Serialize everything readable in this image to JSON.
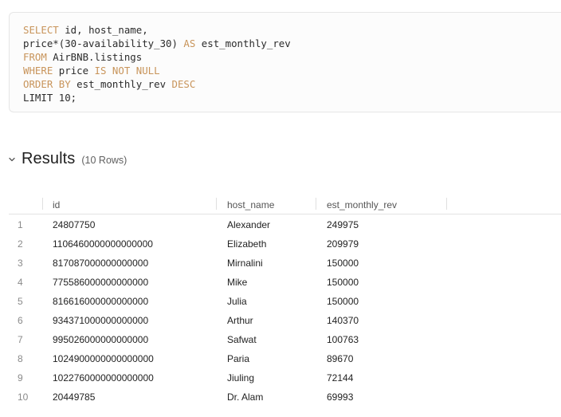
{
  "query": {
    "lines": [
      [
        {
          "t": "SELECT",
          "k": true
        },
        {
          "t": " id, host_name,",
          "k": false
        }
      ],
      [
        {
          "t": "price*(30-availability_30) ",
          "k": false
        },
        {
          "t": "AS",
          "k": true
        },
        {
          "t": " est_monthly_rev",
          "k": false
        }
      ],
      [
        {
          "t": "FROM",
          "k": true
        },
        {
          "t": " AirBNB.listings",
          "k": false
        }
      ],
      [
        {
          "t": "WHERE",
          "k": true
        },
        {
          "t": " price ",
          "k": false
        },
        {
          "t": "IS NOT NULL",
          "k": true
        }
      ],
      [
        {
          "t": "ORDER BY",
          "k": true
        },
        {
          "t": " est_monthly_rev ",
          "k": false
        },
        {
          "t": "DESC",
          "k": true
        }
      ],
      [
        {
          "t": "LIMIT 10;",
          "k": false
        }
      ]
    ]
  },
  "results": {
    "title": "Results",
    "count_label": "(10 Rows)",
    "columns": [
      "id",
      "host_name",
      "est_monthly_rev"
    ],
    "rows": [
      {
        "num": "1",
        "id": "24807750",
        "host_name": "Alexander",
        "est_monthly_rev": "249975"
      },
      {
        "num": "2",
        "id": "1106460000000000000",
        "host_name": "Elizabeth",
        "est_monthly_rev": "209979"
      },
      {
        "num": "3",
        "id": "817087000000000000",
        "host_name": "Mirnalini",
        "est_monthly_rev": "150000"
      },
      {
        "num": "4",
        "id": "775586000000000000",
        "host_name": "Mike",
        "est_monthly_rev": "150000"
      },
      {
        "num": "5",
        "id": "816616000000000000",
        "host_name": "Julia",
        "est_monthly_rev": "150000"
      },
      {
        "num": "6",
        "id": "934371000000000000",
        "host_name": "Arthur",
        "est_monthly_rev": "140370"
      },
      {
        "num": "7",
        "id": "995026000000000000",
        "host_name": "Safwat",
        "est_monthly_rev": "100763"
      },
      {
        "num": "8",
        "id": "1024900000000000000",
        "host_name": "Paria",
        "est_monthly_rev": "89670"
      },
      {
        "num": "9",
        "id": "1022760000000000000",
        "host_name": "Jiuling",
        "est_monthly_rev": "72144"
      },
      {
        "num": "10",
        "id": "20449785",
        "host_name": "Dr. Alam",
        "est_monthly_rev": "69993"
      }
    ]
  },
  "colors": {
    "keyword": "#c8945a",
    "border": "#e6e6e6"
  }
}
